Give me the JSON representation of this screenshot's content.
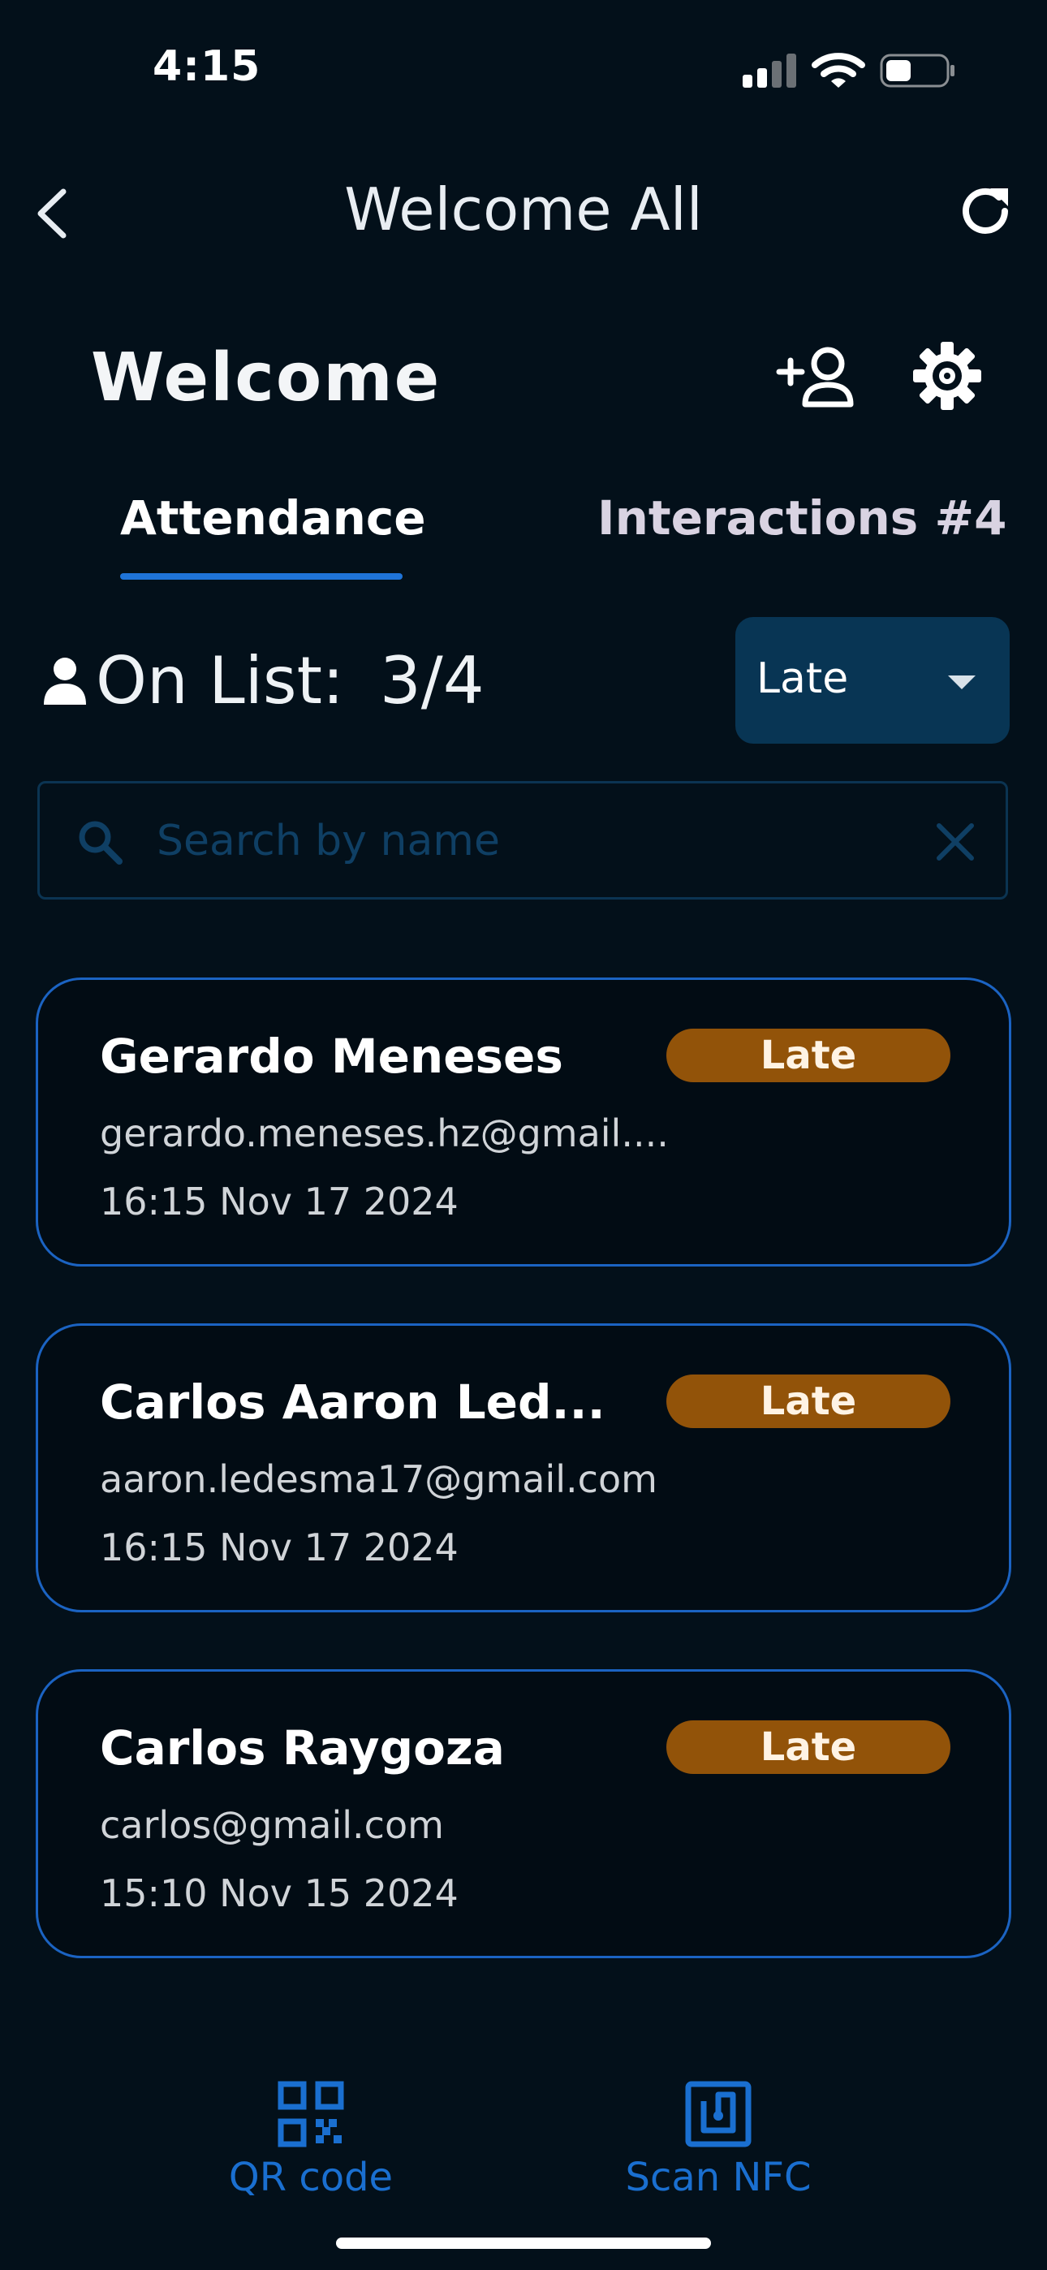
{
  "status_bar": {
    "time": "4:15"
  },
  "nav": {
    "title": "Welcome All"
  },
  "header": {
    "title": "Welcome"
  },
  "tabs": [
    {
      "label": "Attendance",
      "active": true
    },
    {
      "label": "Interactions #4",
      "active": false
    }
  ],
  "on_list": {
    "label": "On List:",
    "count": "3/4"
  },
  "filter": {
    "selected": "Late"
  },
  "search": {
    "placeholder": "Search by name",
    "value": ""
  },
  "attendees": [
    {
      "name": "Gerardo Meneses",
      "email": "gerardo.meneses.hz@gmail....",
      "time": "16:15 Nov 17 2024",
      "status": "Late"
    },
    {
      "name": "Carlos Aaron Led...",
      "email": "aaron.ledesma17@gmail.com",
      "time": "16:15 Nov 17 2024",
      "status": "Late"
    },
    {
      "name": "Carlos Raygoza",
      "email": "carlos@gmail.com",
      "time": "15:10 Nov 15 2024",
      "status": "Late"
    }
  ],
  "bottom_nav": [
    {
      "label": "QR code",
      "icon": "qr-code-icon"
    },
    {
      "label": "Scan NFC",
      "icon": "nfc-icon"
    }
  ],
  "colors": {
    "background": "#03101a",
    "accent": "#1f74d8",
    "dropdown": "#083554",
    "badge_late": "#925309",
    "card_border": "#1b63c2"
  }
}
